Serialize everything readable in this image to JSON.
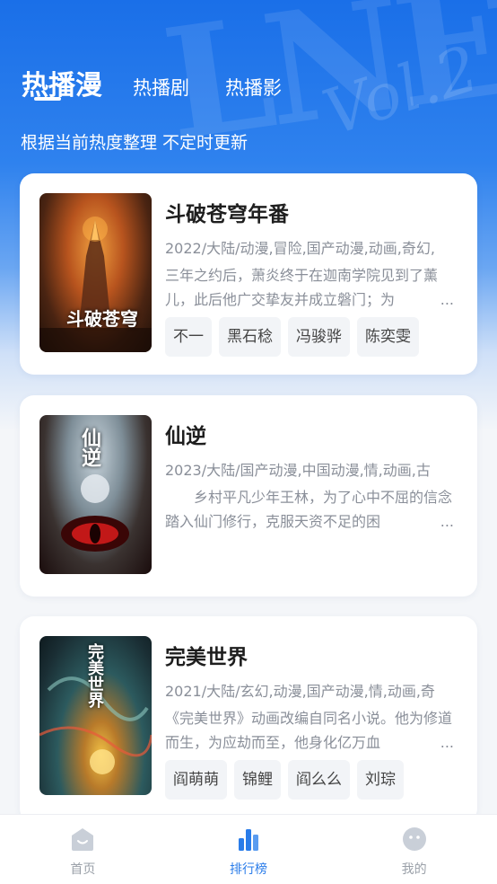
{
  "header": {
    "tabs": [
      {
        "label": "热播漫",
        "active": true
      },
      {
        "label": "热播剧",
        "active": false
      },
      {
        "label": "热播影",
        "active": false
      }
    ],
    "subtitle": "根据当前热度整理 不定时更新"
  },
  "items": [
    {
      "title": "斗破苍穹年番",
      "meta": "2022/大陆/动漫,冒险,国产动漫,动画,奇幻,",
      "desc": "三年之约后，萧炎终于在迦南学院见到了薰儿，此后他广交挚友并成立磐门；为",
      "tags": [
        "不一",
        "黑石稔",
        "冯骏骅",
        "陈奕雯"
      ],
      "poster_text": "斗破苍穹"
    },
    {
      "title": "仙逆",
      "meta": "2023/大陆/国产动漫,中国动漫,情,动画,古",
      "desc": "　　乡村平凡少年王林，为了心中不屈的信念踏入仙门修行，克服天资不足的困",
      "tags": [],
      "poster_text": "仙逆"
    },
    {
      "title": "完美世界",
      "meta": "2021/大陆/玄幻,动漫,国产动漫,情,动画,奇",
      "desc": "《完美世界》动画改编自同名小说。他为修道而生，为应劫而至，他身化亿万血",
      "tags": [
        "阎萌萌",
        "锦鲤",
        "阎么么",
        "刘琮"
      ],
      "poster_text": "完美世界"
    }
  ],
  "ellipsis": "...",
  "nav": [
    {
      "label": "首页",
      "icon": "home-icon",
      "active": false
    },
    {
      "label": "排行榜",
      "icon": "ranking-icon",
      "active": true
    },
    {
      "label": "我的",
      "icon": "profile-icon",
      "active": false
    }
  ],
  "colors": {
    "accent": "#2a7ce9",
    "hero": "#1a6fe8",
    "inactive": "#9aa0a8"
  }
}
